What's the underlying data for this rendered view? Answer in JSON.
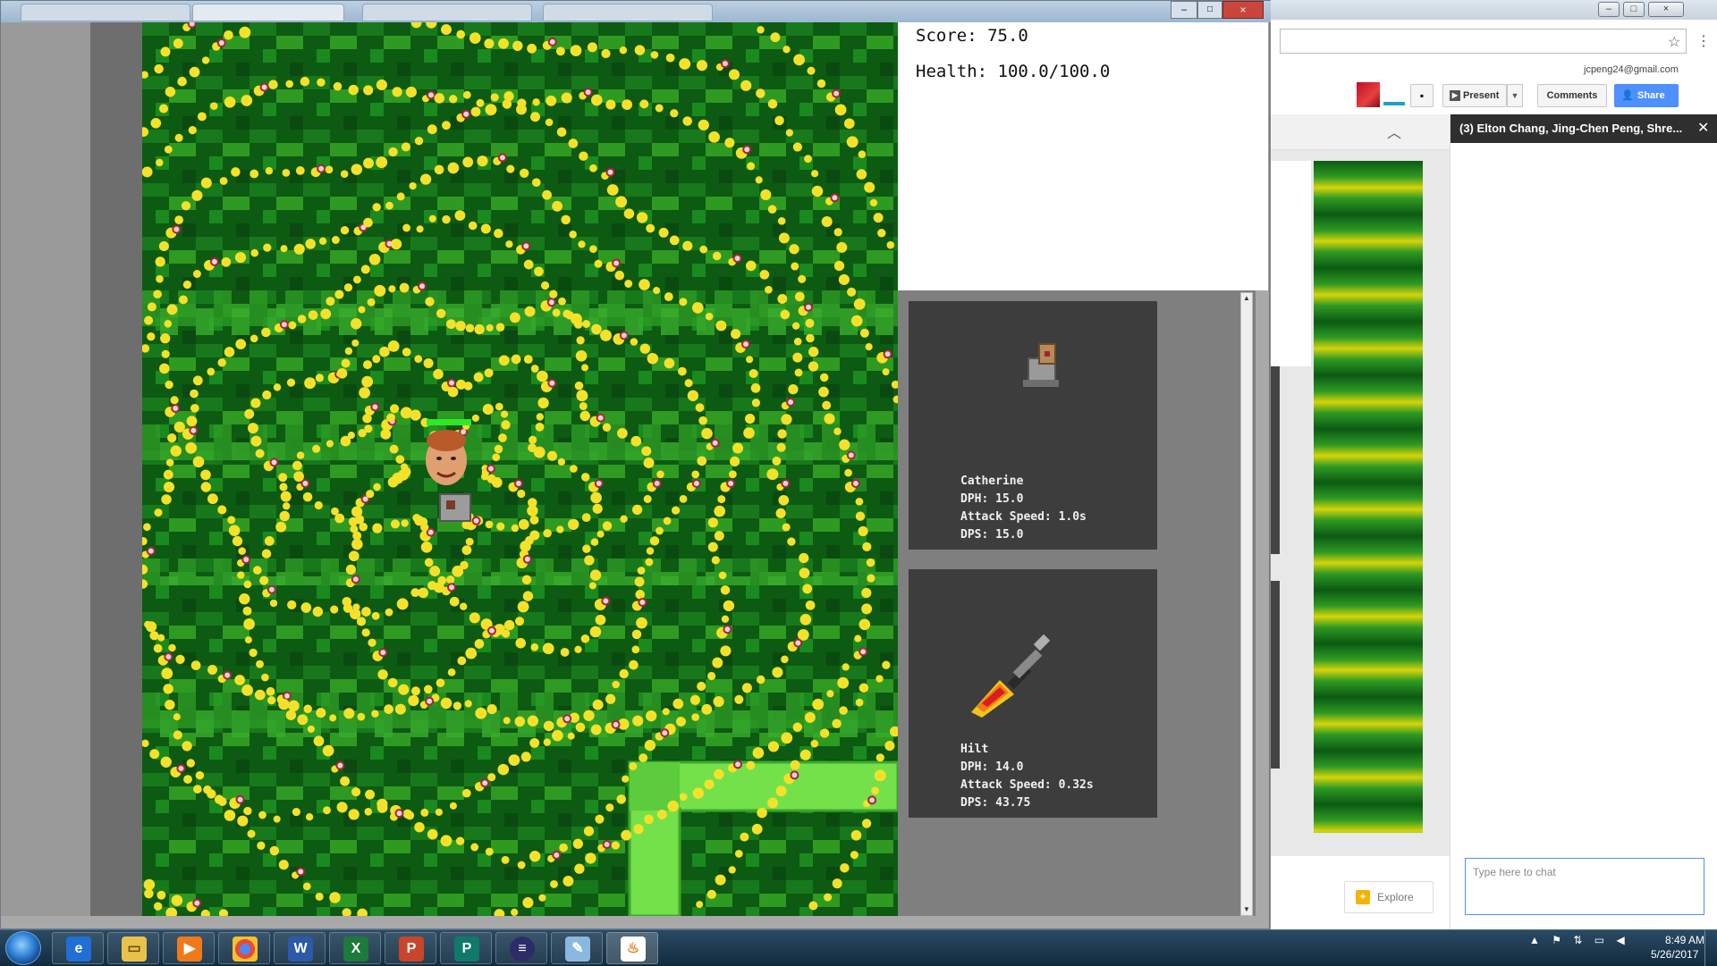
{
  "browser": {
    "email": "jcpeng24@gmail.com",
    "present_label": "Present",
    "comments_label": "Comments",
    "share_label": "Share",
    "explore_label": "Explore",
    "chat_title": "(3) Elton Chang, Jing-Chen Peng, Shre...",
    "chat_placeholder": "Type here to chat"
  },
  "game": {
    "score_label": "Score: 75.0",
    "health_label": "Health: 100.0/100.0",
    "player_health_fraction": 1.0,
    "weapons": [
      {
        "name": "Catherine",
        "dph": "DPH: 15.0",
        "attack_speed": "Attack Speed: 1.0s",
        "dps": "DPS: 15.0",
        "icon": "turret-icon"
      },
      {
        "name": "Hilt",
        "dph": "DPH: 14.0",
        "attack_speed": "Attack Speed: 0.32s",
        "dps": "DPS: 43.75",
        "icon": "flaming-sword-icon"
      }
    ]
  },
  "taskbar": {
    "time": "8:49 AM",
    "date": "5/26/2017",
    "apps": [
      "windows-explorer-ie-icon",
      "file-explorer-icon",
      "media-player-icon",
      "chrome-icon",
      "word-icon",
      "excel-icon",
      "powerpoint-icon",
      "publisher-icon",
      "eclipse-icon",
      "paint-icon",
      "java-icon"
    ]
  },
  "colors": {
    "grass_dark": "#0d5a12",
    "grass_light": "#2e9a22",
    "bullet": "#f5e12a",
    "path": "#74e14a",
    "share_blue": "#4d90fe"
  }
}
